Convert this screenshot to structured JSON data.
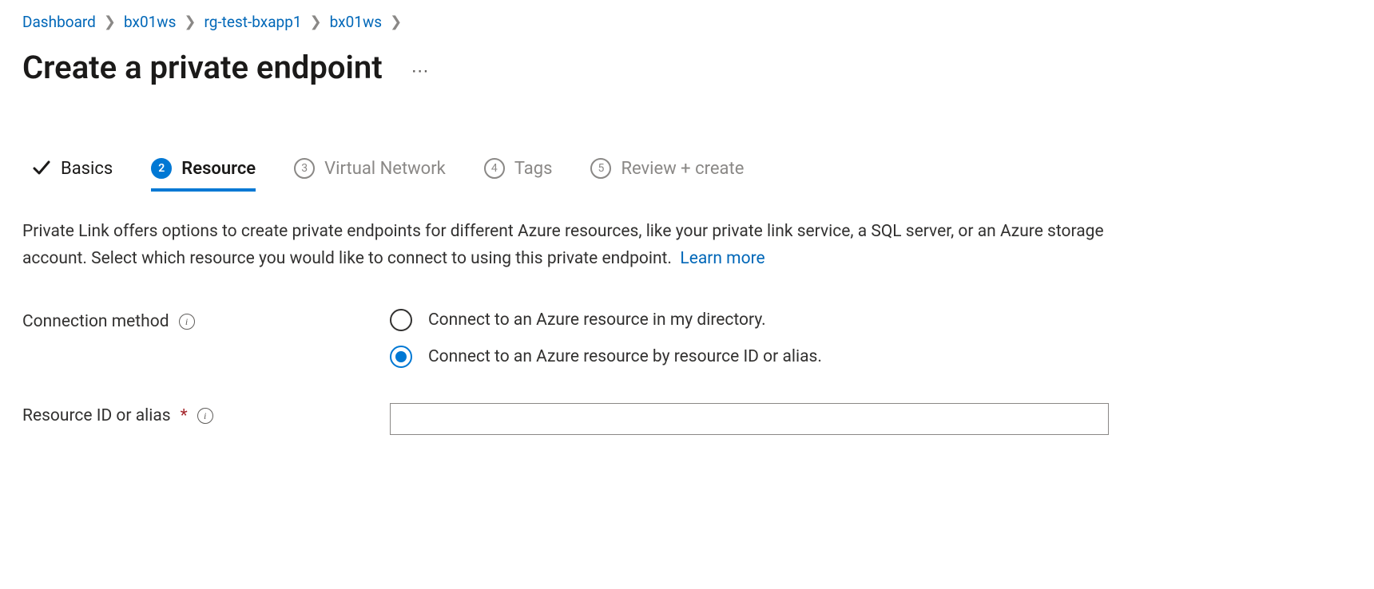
{
  "breadcrumb": {
    "items": [
      {
        "label": "Dashboard"
      },
      {
        "label": "bx01ws"
      },
      {
        "label": "rg-test-bxapp1"
      },
      {
        "label": "bx01ws"
      }
    ]
  },
  "title": "Create a private endpoint",
  "wizard": {
    "steps": [
      {
        "num": "",
        "label": "Basics",
        "state": "done"
      },
      {
        "num": "2",
        "label": "Resource",
        "state": "active"
      },
      {
        "num": "3",
        "label": "Virtual Network",
        "state": "pending"
      },
      {
        "num": "4",
        "label": "Tags",
        "state": "pending"
      },
      {
        "num": "5",
        "label": "Review + create",
        "state": "pending"
      }
    ]
  },
  "description": {
    "text": "Private Link offers options to create private endpoints for different Azure resources, like your private link service, a SQL server, or an Azure storage account. Select which resource you would like to connect to using this private endpoint.",
    "learn_more": "Learn more"
  },
  "form": {
    "connection_method": {
      "label": "Connection method",
      "options": [
        {
          "label": "Connect to an Azure resource in my directory.",
          "selected": false
        },
        {
          "label": "Connect to an Azure resource by resource ID or alias.",
          "selected": true
        }
      ]
    },
    "resource_id": {
      "label": "Resource ID or alias",
      "required": true,
      "value": ""
    }
  }
}
